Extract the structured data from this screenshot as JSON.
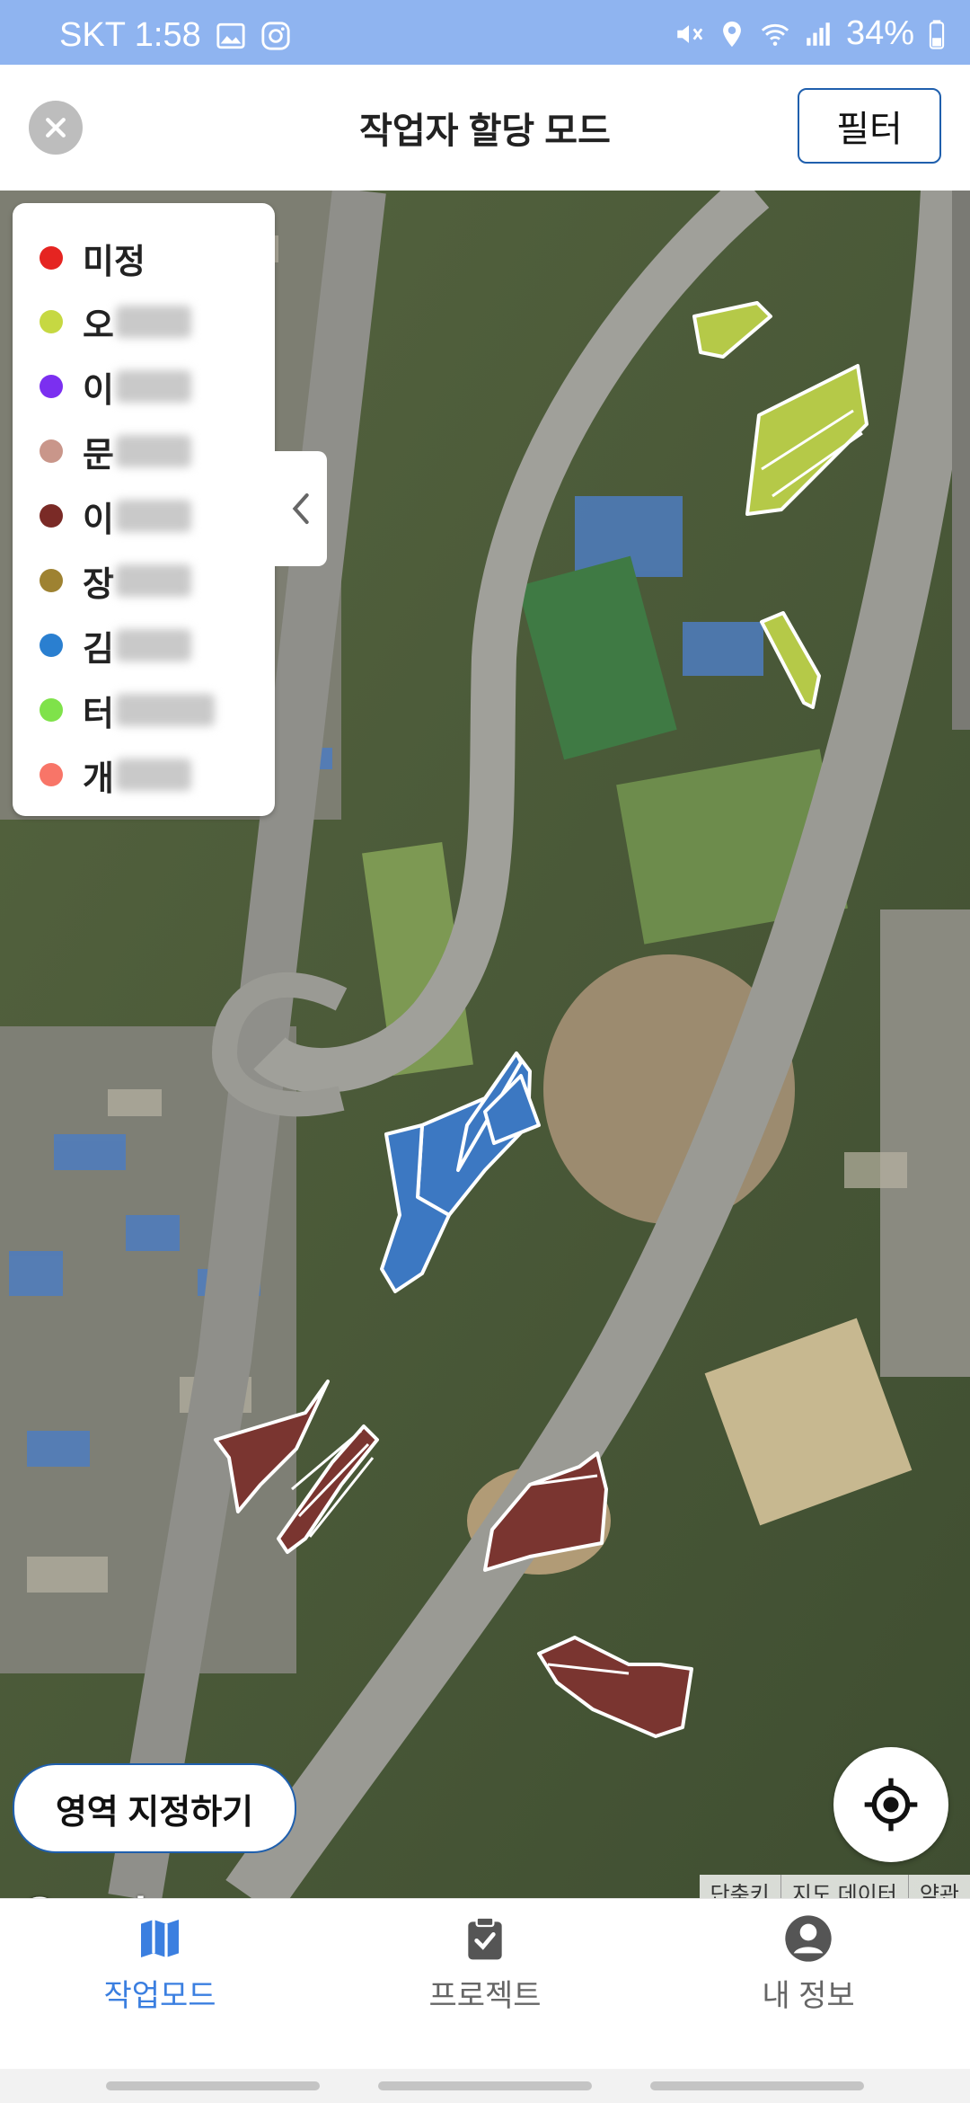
{
  "status_bar": {
    "carrier_time": "SKT 1:58",
    "battery": "34%",
    "icons": [
      "gallery-icon",
      "instagram-icon",
      "mute-icon",
      "location-icon",
      "wifi-icon",
      "signal-icon",
      "battery-icon"
    ]
  },
  "header": {
    "title": "작업자 할당 모드",
    "filter_label": "필터"
  },
  "legend": {
    "items": [
      {
        "label": "미정",
        "color": "#e52421",
        "obscured": false
      },
      {
        "label": "오",
        "color": "#c6d842",
        "obscured": true
      },
      {
        "label": "이",
        "color": "#7b2ff0",
        "obscured": true
      },
      {
        "label": "문",
        "color": "#c9968a",
        "obscured": true
      },
      {
        "label": "이",
        "color": "#7a2a26",
        "obscured": true
      },
      {
        "label": "장",
        "color": "#9e8231",
        "obscured": true
      },
      {
        "label": "김",
        "color": "#2a7fd0",
        "obscured": true
      },
      {
        "label": "터",
        "color": "#7fe24a",
        "obscured": true
      },
      {
        "label": "개",
        "color": "#f87568",
        "obscured": true
      }
    ]
  },
  "map": {
    "area_button_label": "영역 지정하기",
    "google_label": "Google",
    "attribution": [
      "단축키",
      "지도 데이터",
      "약관"
    ]
  },
  "bottom_nav": {
    "items": [
      {
        "label": "작업모드",
        "icon": "map-icon",
        "active": true
      },
      {
        "label": "프로젝트",
        "icon": "clipboard-check-icon",
        "active": false
      },
      {
        "label": "내 정보",
        "icon": "person-icon",
        "active": false
      }
    ],
    "active_color": "#3b7fe0",
    "inactive_color": "#666666"
  }
}
